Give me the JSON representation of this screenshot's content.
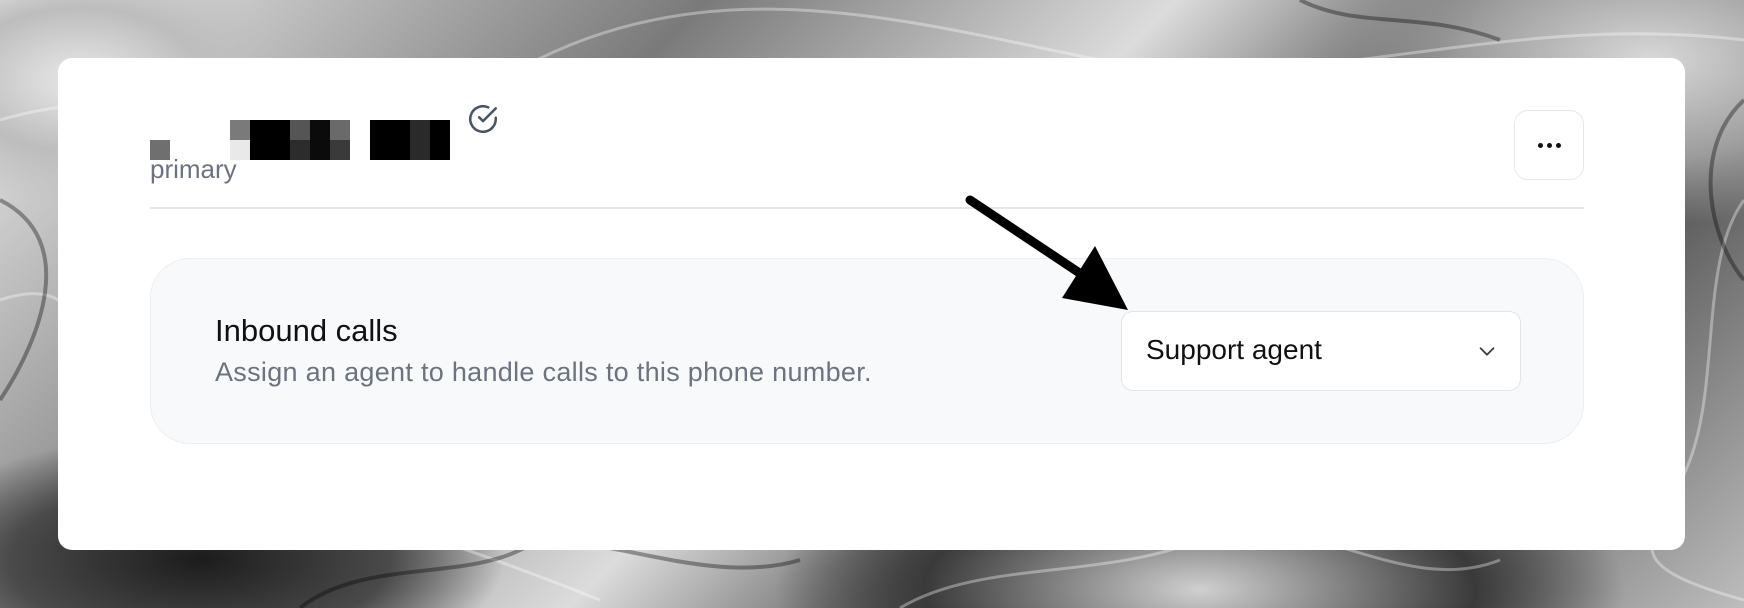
{
  "account": {
    "subtitle": "primary",
    "verified_icon": "check-circle-icon"
  },
  "menu": {
    "more_icon": "ellipsis-horizontal-icon"
  },
  "inbound_calls": {
    "title": "Inbound calls",
    "description": "Assign an agent to handle calls to this phone number.",
    "selected_agent": "Support agent",
    "dropdown_icon": "chevron-down-icon"
  },
  "annotation": {
    "arrow_icon": "pointer-arrow-icon",
    "color": "#000000"
  },
  "colors": {
    "card": "#ffffff",
    "panel": "#f8f9fb",
    "muted_text": "#6b7280"
  }
}
